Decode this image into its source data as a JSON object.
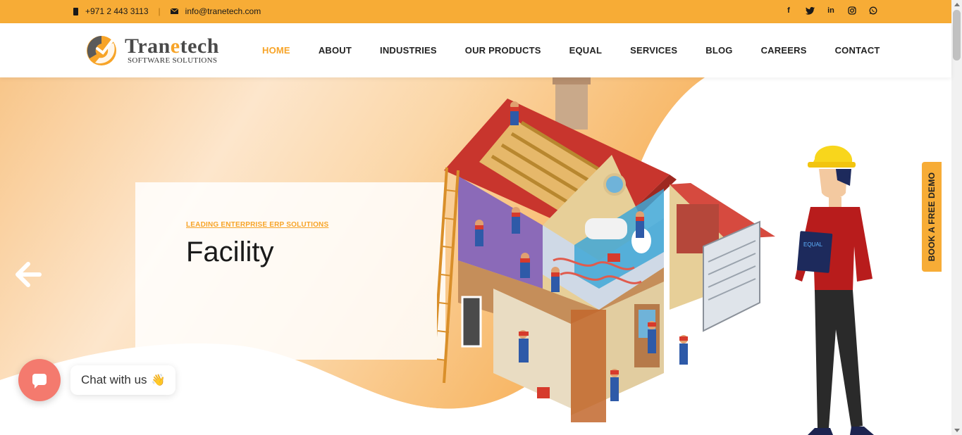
{
  "topbar": {
    "phone": "+971 2 443 3113",
    "email": "info@tranetech.com",
    "socials": [
      "facebook-icon",
      "twitter-icon",
      "linkedin-icon",
      "instagram-icon",
      "whatsapp-icon"
    ],
    "color": "#f7ac36"
  },
  "brand": {
    "name_pre": "Tran",
    "name_accent": "e",
    "name_post": "tech",
    "tagline": "SOFTWARE SOLUTIONS",
    "accent": "#f7a428"
  },
  "nav": {
    "items": [
      {
        "label": "HOME",
        "active": true
      },
      {
        "label": "ABOUT"
      },
      {
        "label": "INDUSTRIES"
      },
      {
        "label": "OUR PRODUCTS"
      },
      {
        "label": "EQUAL"
      },
      {
        "label": "SERVICES"
      },
      {
        "label": "BLOG"
      },
      {
        "label": "CAREERS"
      },
      {
        "label": "CONTACT"
      }
    ]
  },
  "hero": {
    "eyebrow": "LEADING ENTERPRISE ERP SOLUTIONS",
    "headline": "Facility",
    "clipboard_label": "EQUAL"
  },
  "demo_tab": {
    "label": "BOOK A FREE DEMO"
  },
  "chat": {
    "label": "Chat with us",
    "emoji": "👋"
  }
}
